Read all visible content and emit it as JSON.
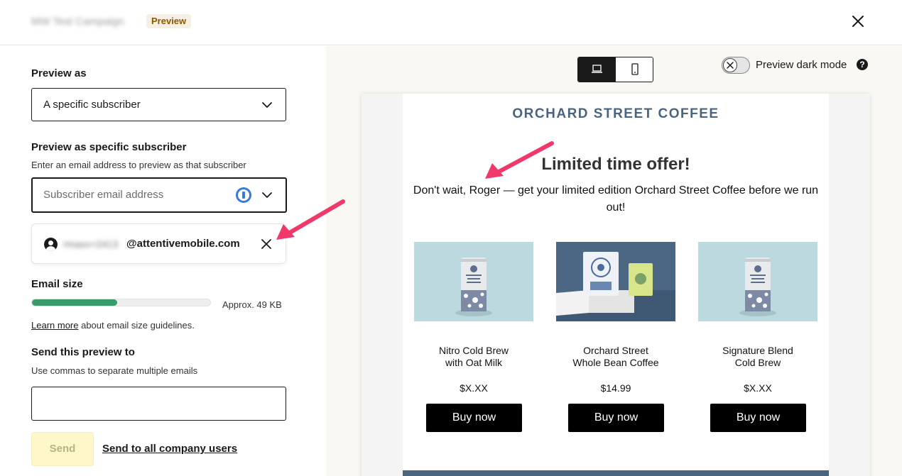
{
  "header": {
    "campaign_name": "MW Test Campaign",
    "badge": "Preview",
    "close_icon": "close-icon"
  },
  "left_panel": {
    "preview_as_label": "Preview as",
    "preview_as_value": "A specific subscriber",
    "specific_label": "Preview as specific subscriber",
    "specific_help": "Enter an email address to preview as that subscriber",
    "email_placeholder": "Subscriber email address",
    "subscriber_local": "rmaxx+2413",
    "subscriber_domain": "@attentivemobile.com",
    "email_size_label": "Email size",
    "email_size_fraction": 0.48,
    "email_size_text": "Approx. 49 KB",
    "learn_more": "Learn more",
    "learn_more_rest": " about email size guidelines.",
    "send_to_label": "Send this preview to",
    "send_to_help": "Use commas to separate multiple emails",
    "send_button": "Send",
    "send_all_link": "Send to all company users"
  },
  "preview_toolbar": {
    "dark_mode_label": "Preview dark mode",
    "help": "?"
  },
  "email": {
    "brand": "ORCHARD STREET COFFEE",
    "headline": "Limited time offer!",
    "body": "Don't wait, Roger — get your limited edition Orchard Street Coffee before we run out!",
    "products": [
      {
        "name_line1": "Nitro Cold Brew",
        "name_line2": "with Oat Milk",
        "price": "$X.XX",
        "button": "Buy now"
      },
      {
        "name_line1": "Orchard Street",
        "name_line2": "Whole Bean Coffee",
        "price": "$14.99",
        "button": "Buy now"
      },
      {
        "name_line1": "Signature Blend",
        "name_line2": "Cold Brew",
        "price": "$X.XX",
        "button": "Buy now"
      }
    ]
  },
  "colors": {
    "brand_blue": "#4a6480",
    "size_bar": "#3a9b6a",
    "arrow": "#f0386b",
    "send_disabled_bg": "#fdf7c9"
  }
}
